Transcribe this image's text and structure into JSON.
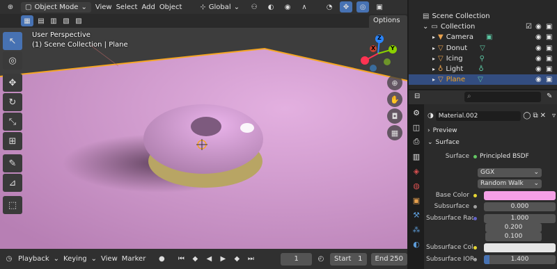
{
  "header": {
    "mode": "Object Mode",
    "menus": [
      "View",
      "Select",
      "Add",
      "Object"
    ],
    "transform": "Global",
    "options": "Options"
  },
  "viewport": {
    "perspective": "User Perspective",
    "context": "(1) Scene Collection | Plane",
    "gizmo": {
      "z": "Z",
      "y": "Y",
      "x": "X"
    }
  },
  "timeline": {
    "menus": [
      "Playback",
      "Keying",
      "View",
      "Marker"
    ],
    "current_frame": "1",
    "start_label": "Start",
    "start": "1",
    "end_label": "End",
    "end": "250"
  },
  "outliner": {
    "title": "Scene Collection",
    "collection": "Collection",
    "items": [
      "Camera",
      "Donut",
      "Icing",
      "Light",
      "Plane"
    ],
    "selected": "Plane"
  },
  "properties": {
    "material": "Material.002",
    "preview": "Preview",
    "surface_header": "Surface",
    "surface_label": "Surface",
    "surface_value": "Principled BSDF",
    "distribution": "GGX",
    "subsurface_method": "Random Walk",
    "base_color_label": "Base Color",
    "base_color": "#f5a0e6",
    "subsurface_label": "Subsurface",
    "subsurface": "0.000",
    "radius_label": "Subsurface Radi...",
    "radius": [
      "1.000",
      "0.200",
      "0.100"
    ],
    "ss_color_label": "Subsurface Color",
    "ss_color": "#e6e6e6",
    "ior_label": "Subsurface IOR",
    "ior": "1.400"
  },
  "colors": {
    "accent": "#4772b3",
    "plane": "#c98fc7",
    "icing": "#d49bd4",
    "dough": "#b8a564",
    "selection": "#f5a623"
  }
}
